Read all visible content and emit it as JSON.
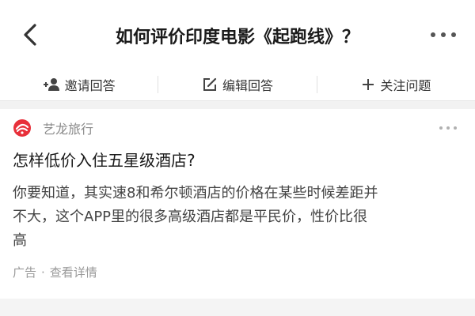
{
  "header": {
    "title": "如何评价印度电影《起跑线》？",
    "back_icon": "chevron-left-icon",
    "more_icon": "more-horizontal-icon"
  },
  "actions": [
    {
      "label": "邀请回答",
      "icon": "add-user-icon"
    },
    {
      "label": "编辑回答",
      "icon": "edit-icon"
    },
    {
      "label": "关注问题",
      "icon": "plus-icon"
    }
  ],
  "ad": {
    "brand_name": "艺龙旅行",
    "brand_logo_icon": "elong-logo-icon",
    "brand_color": "#e8303a",
    "title": "怎样低价入住五星级酒店?",
    "description_lines": [
      "你要知道，其实速8和希尔顿酒店的价格在某些时候差距并",
      "不大，这个APP里的很多高级酒店都是平民价，性价比很",
      "高"
    ],
    "footer_tag": "广告",
    "footer_separator": "·",
    "footer_link": "查看详情"
  }
}
